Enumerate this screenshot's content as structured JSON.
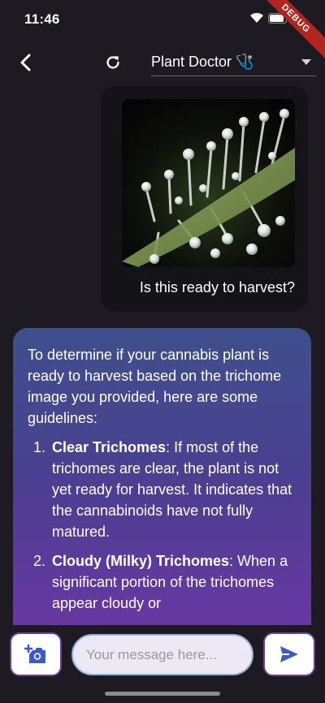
{
  "status_bar": {
    "time": "11:46",
    "debug_label": "DEBUG"
  },
  "app_bar": {
    "back_icon": "back-arrow-icon",
    "refresh_icon": "refresh-icon",
    "model_selected": "Plant Doctor 🩺"
  },
  "chat": {
    "user_message": {
      "text": "Is this ready to harvest?",
      "image": "trichome-photo"
    },
    "bot_message": {
      "intro": "To determine if your cannabis plant is ready to harvest based on the trichome image you provided, here are some guidelines:",
      "items": [
        {
          "num": "1.",
          "term": "Clear Trichomes",
          "text": ": If most of the trichomes are clear, the plant is not yet ready for harvest. It indicates that the cannabinoids have not fully matured."
        },
        {
          "num": "2.",
          "term": "Cloudy (Milky) Trichomes",
          "text": ": When a significant portion of the trichomes appear cloudy or"
        }
      ]
    }
  },
  "input_bar": {
    "placeholder": "Your message here...",
    "camera_icon": "add-photo-icon",
    "send_icon": "send-icon"
  },
  "colors": {
    "background": "#1d1b21",
    "accent": "#6b3fa0",
    "icon_blue": "#3d5bc7"
  }
}
